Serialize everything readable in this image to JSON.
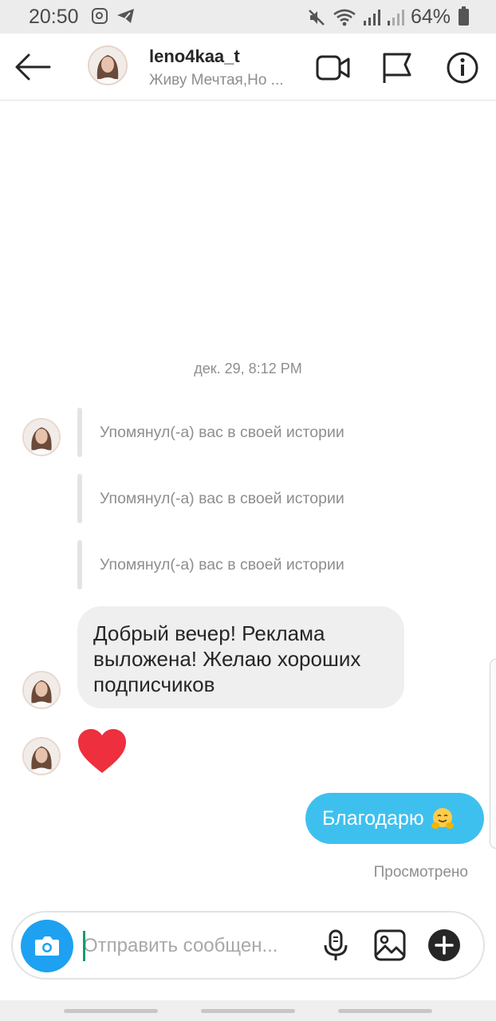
{
  "status_bar": {
    "time": "20:50",
    "battery": "64%",
    "icons": [
      "instagram-icon",
      "telegram-icon",
      "mute-icon",
      "wifi-icon",
      "signal-icon",
      "battery-icon"
    ]
  },
  "header": {
    "username": "leno4kaa_t",
    "subtitle": "Живу Мечтая,Но ...",
    "icons": [
      "back-arrow-icon",
      "video-call-icon",
      "flag-icon",
      "info-icon"
    ]
  },
  "chat": {
    "date": "дек. 29, 8:12 PM",
    "mentions": [
      "Упомянул(-а) вас в своей истории",
      "Упомянул(-а) вас в своей истории",
      "Упомянул(-а) вас в своей истории"
    ],
    "incoming_message_lines": [
      "Добрый вечер! Реклама",
      "выложена! Желаю хороших",
      "подписчиков"
    ],
    "outgoing_message": "Благодарю",
    "outgoing_emoji": "🤗",
    "seen": "Просмотрено"
  },
  "composer": {
    "placeholder": "Отправить сообщен..."
  },
  "colors": {
    "accent_blue": "#1ea1f1",
    "outgoing_bubble": "#3ec0ee",
    "incoming_bubble": "#efefef",
    "heart": "#ed2f3e",
    "muted_text": "#8e8e8e"
  }
}
